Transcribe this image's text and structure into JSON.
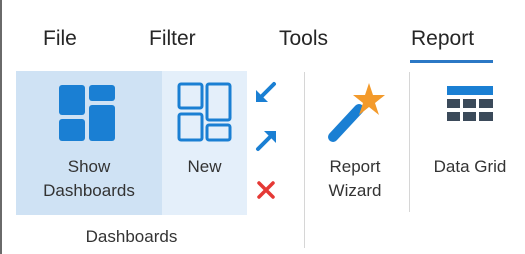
{
  "menu": {
    "tabs": [
      {
        "label": "File"
      },
      {
        "label": "Filter"
      },
      {
        "label": "Tools"
      },
      {
        "label": "Report",
        "active": true
      }
    ]
  },
  "ribbon": {
    "show_dashboards": {
      "line1": "Show",
      "line2": "Dashboards",
      "icon": "dashboard-grid-icon"
    },
    "new": {
      "label": "New",
      "icon": "new-layout-icon"
    },
    "small_actions": [
      {
        "icon": "arrow-down-left-icon"
      },
      {
        "icon": "arrow-up-right-icon"
      },
      {
        "icon": "close-icon"
      }
    ],
    "group_label": "Dashboards",
    "report_wizard": {
      "line1": "Report",
      "line2": "Wizard",
      "icon": "magic-wand-icon"
    },
    "data_grid": {
      "label": "Data Grid",
      "icon": "table-grid-icon"
    }
  },
  "colors": {
    "accent": "#2b78c5",
    "icon_blue": "#1a7fd3",
    "table_dark": "#3b4a5a",
    "delete_red": "#e53935",
    "star_orange": "#f39a2b",
    "selected_bg": "#cfe2f4",
    "hover_bg": "#e4effa"
  }
}
